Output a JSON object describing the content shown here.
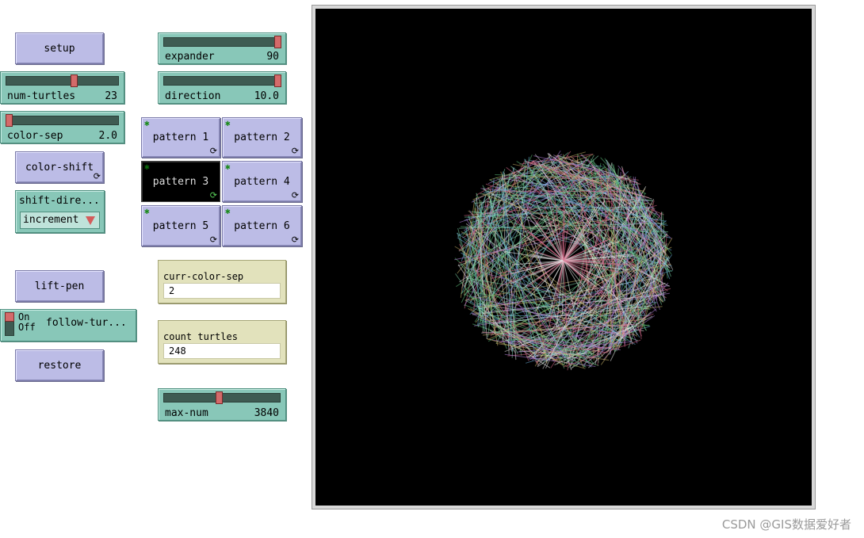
{
  "buttons": {
    "setup": "setup",
    "color_shift": "color-shift",
    "lift_pen": "lift-pen",
    "restore": "restore",
    "forever_glyph": "⟳",
    "agent_glyph": "✱",
    "patterns": [
      "pattern 1",
      "pattern 2",
      "pattern 3",
      "pattern 4",
      "pattern 5",
      "pattern 6"
    ],
    "pressed_pattern": "pattern 3"
  },
  "sliders": {
    "num_turtles": {
      "label": "num-turtles",
      "value": "23",
      "fraction": 0.6
    },
    "color_sep": {
      "label": "color-sep",
      "value": "2.0",
      "fraction": 0.02
    },
    "expander": {
      "label": "expander",
      "value": "90",
      "fraction": 0.98
    },
    "direction": {
      "label": "direction",
      "value": "10.0",
      "fraction": 0.98
    },
    "max_num": {
      "label": "max-num",
      "value": "3840",
      "fraction": 0.47
    }
  },
  "chooser": {
    "label": "shift-dire...",
    "selected": "increment"
  },
  "switch": {
    "label": "follow-tur...",
    "on_text": "On",
    "off_text": "Off",
    "state": "on"
  },
  "monitors": {
    "curr_color_sep": {
      "label": "curr-color-sep",
      "value": "2"
    },
    "count_turtles": {
      "label": "count turtles",
      "value": "248"
    }
  },
  "view": {
    "background": "#000000",
    "pattern_colors": [
      "#7fd3a8",
      "#e8e8e8",
      "#d96a8a",
      "#c9b36a",
      "#6ab0d9",
      "#b07fd9",
      "#5fbf7a"
    ]
  },
  "watermark": "CSDN @GIS数据爱好者"
}
